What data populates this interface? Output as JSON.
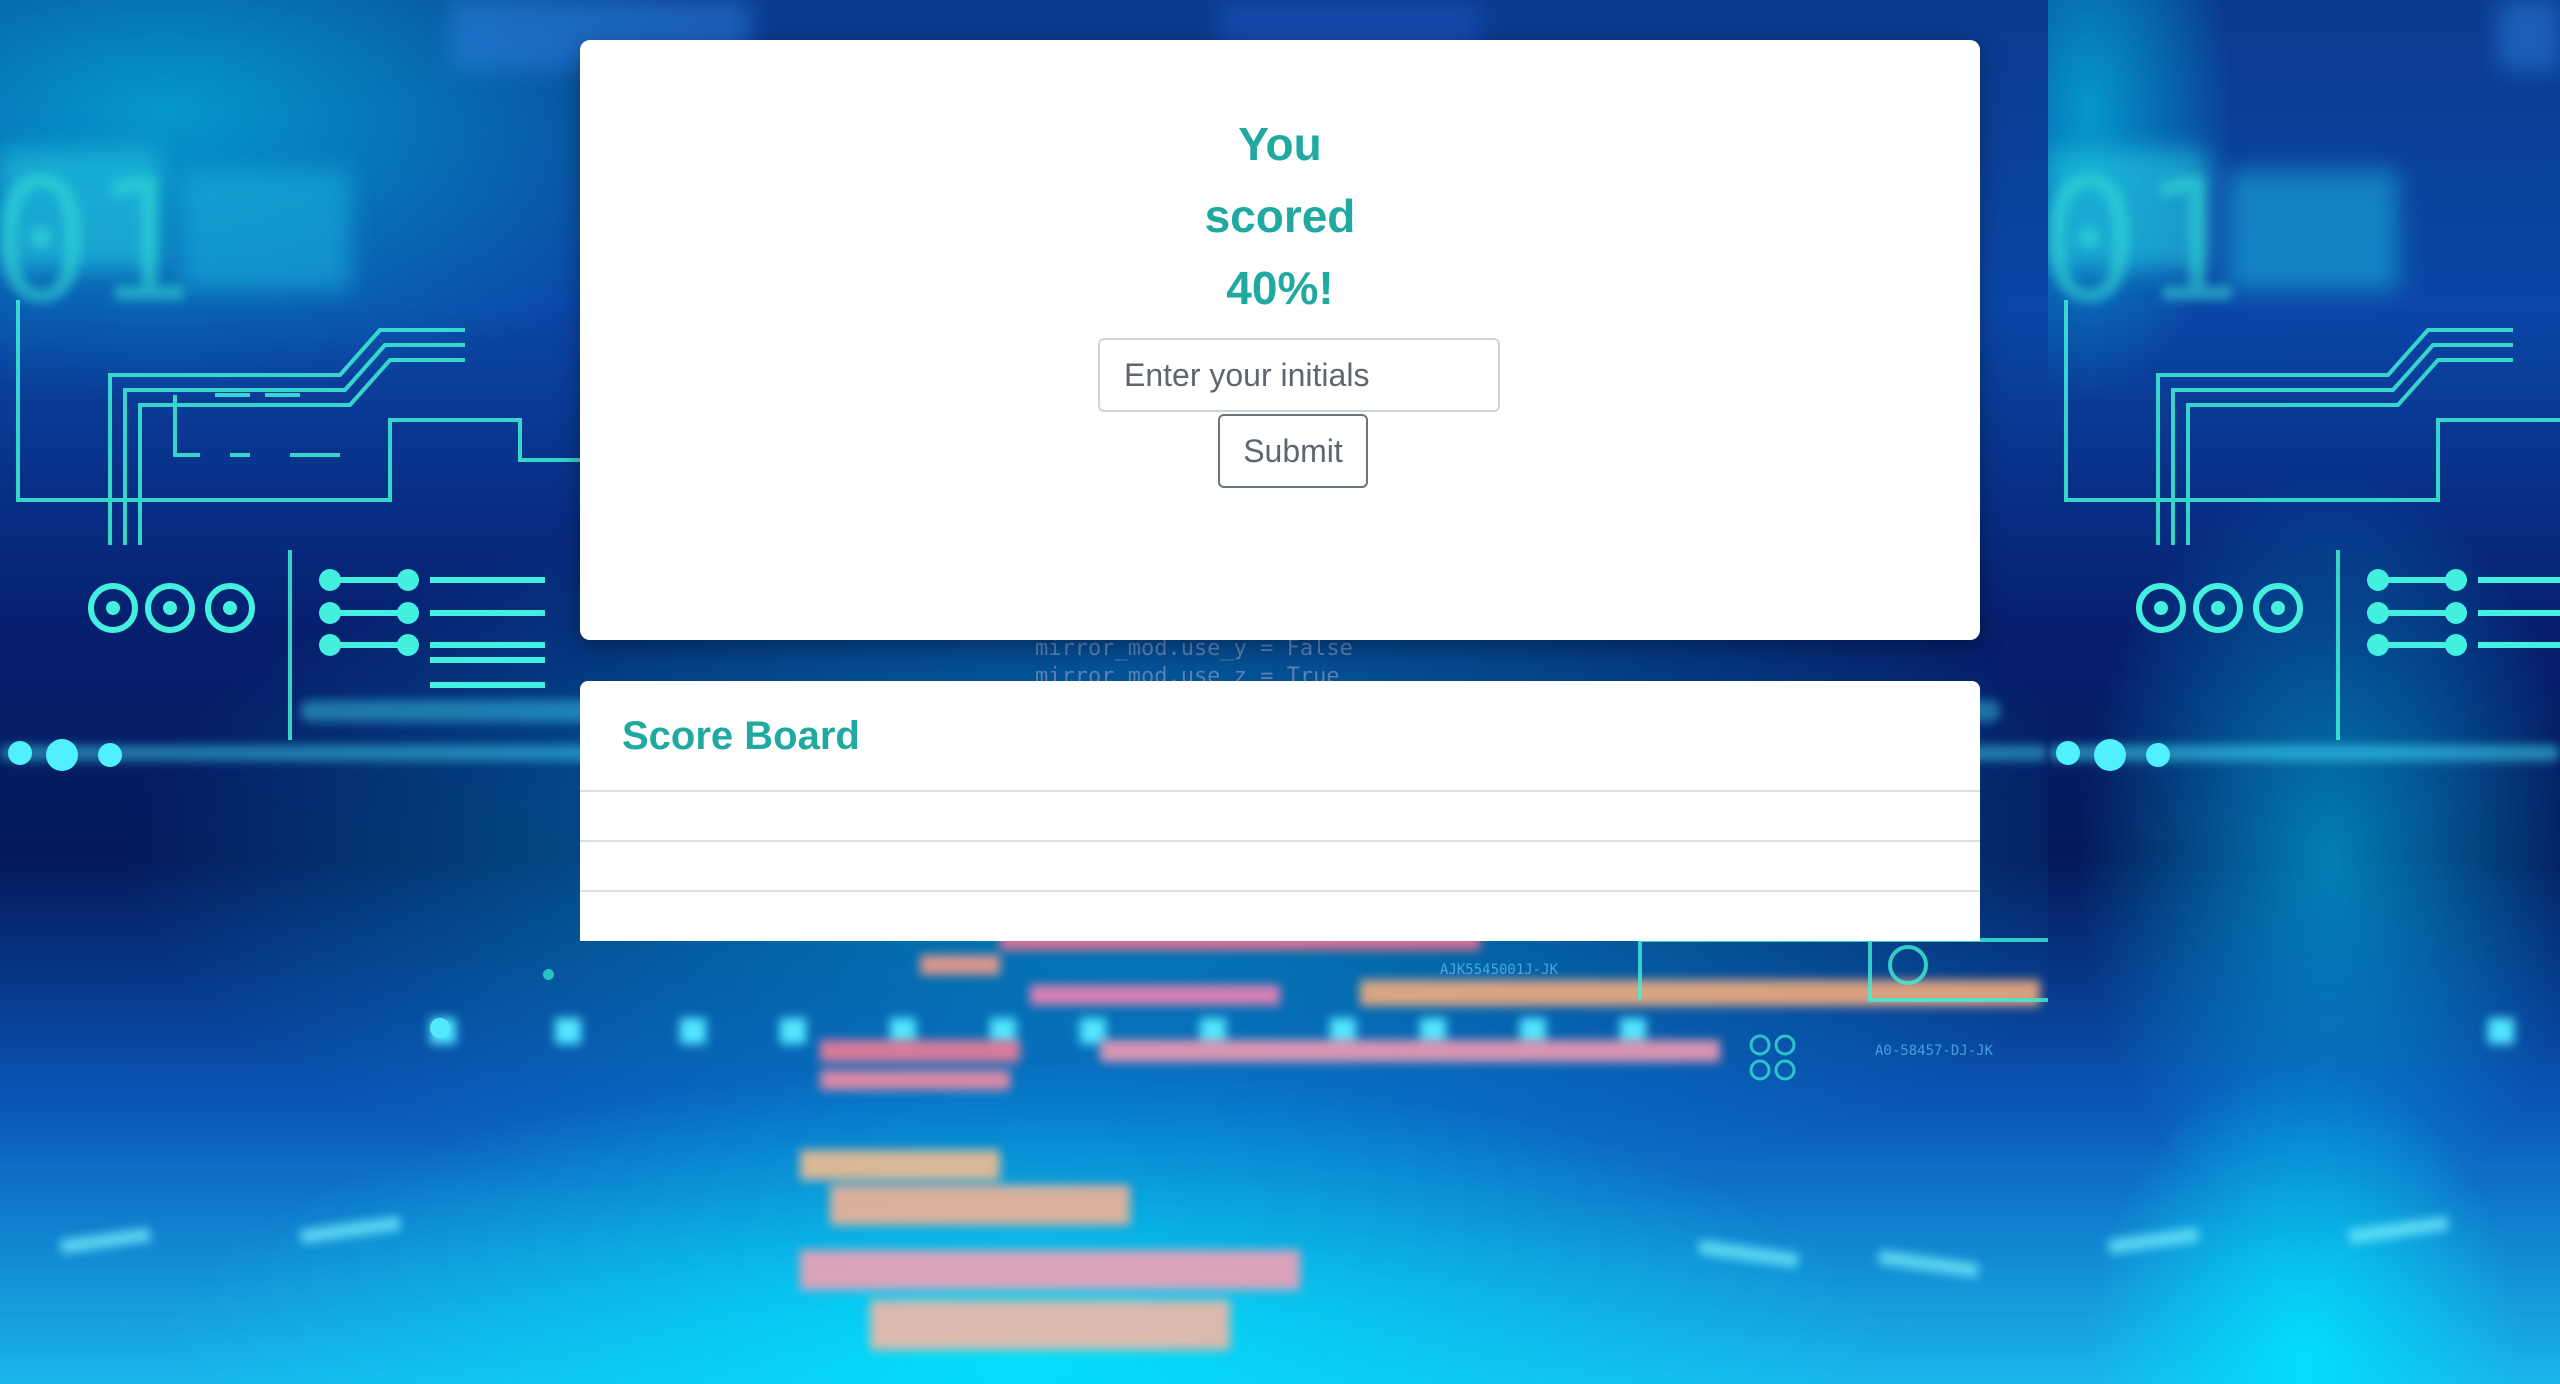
{
  "quiz_result": {
    "line_1": "You",
    "line_2": "scored",
    "line_3": "40%!",
    "score_percent": 40,
    "initials_placeholder": "Enter your initials",
    "initials_value": "",
    "submit_label": "Submit"
  },
  "score_board": {
    "title": "Score Board",
    "entries": [
      "",
      "",
      ""
    ]
  },
  "colors": {
    "accent": "#1fa9a1",
    "card_background": "#ffffff",
    "page_background": "#03134a"
  },
  "background": {
    "code_line_1": "mirror_mod.use_y = False",
    "code_line_2": "mirror_mod.use_z = True",
    "part_number_1": "AJK5545001J-JK",
    "part_number_2": "A0-58457-DJ-JK"
  }
}
